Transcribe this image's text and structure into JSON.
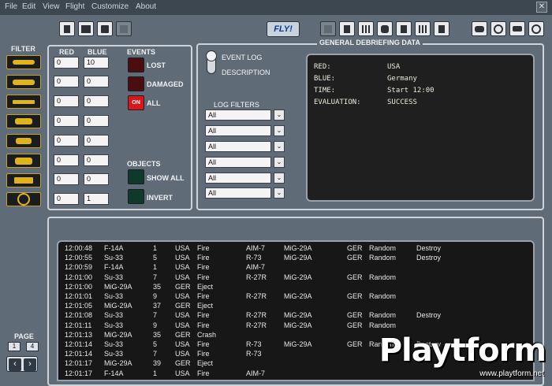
{
  "menu": [
    "File",
    "Edit",
    "View",
    "Flight",
    "Customize",
    "About"
  ],
  "close_glyph": "✕",
  "toolbar": {
    "fly_label": "FLY!"
  },
  "filter": {
    "label": "FILTER"
  },
  "counts": {
    "red_header": "RED",
    "blue_header": "BLUE",
    "red": [
      "0",
      "0",
      "0",
      "0",
      "0",
      "0",
      "0",
      "0"
    ],
    "blue": [
      "10",
      "0",
      "0",
      "0",
      "0",
      "0",
      "0",
      "1"
    ]
  },
  "events": {
    "header": "EVENTS",
    "lost": "LOST",
    "damaged": "DAMAGED",
    "all": "ALL",
    "on_indicator": "ON"
  },
  "objects": {
    "header": "OBJECTS",
    "show_all": "SHOW ALL",
    "invert": "INVERT"
  },
  "mode": {
    "event_log": "EVENT LOG",
    "description": "DESCRIPTION"
  },
  "log_filters": {
    "label": "LOG FILTERS",
    "values": [
      "All",
      "All",
      "All",
      "All",
      "All",
      "All"
    ]
  },
  "general": {
    "title": "GENERAL DEBRIEFING DATA",
    "rows": [
      {
        "k": "RED:",
        "v": "USA"
      },
      {
        "k": "BLUE:",
        "v": "Germany"
      },
      {
        "k": "TIME:",
        "v": "Start 12:00"
      },
      {
        "k": "EVALUATION:",
        "v": "SUCCESS"
      }
    ]
  },
  "log": [
    [
      "12:00:48",
      "F-14A",
      "1",
      "USA",
      "Fire",
      "AIM-7",
      "MiG-29A",
      "GER",
      "Random",
      "Destroy"
    ],
    [
      "12:00:55",
      "Su-33",
      "5",
      "USA",
      "Fire",
      "R-73",
      "MiG-29A",
      "GER",
      "Random",
      "Destroy"
    ],
    [
      "12:00:59",
      "F-14A",
      "1",
      "USA",
      "Fire",
      "AIM-7",
      "",
      "",
      "",
      ""
    ],
    [
      "12:01:00",
      "Su-33",
      "7",
      "USA",
      "Fire",
      "R-27R",
      "MiG-29A",
      "GER",
      "Random",
      ""
    ],
    [
      "12:01:00",
      "MiG-29A",
      "35",
      "GER",
      "Eject",
      "",
      "",
      "",
      "",
      ""
    ],
    [
      "12:01:01",
      "Su-33",
      "9",
      "USA",
      "Fire",
      "R-27R",
      "MiG-29A",
      "GER",
      "Random",
      ""
    ],
    [
      "12:01:05",
      "MiG-29A",
      "37",
      "GER",
      "Eject",
      "",
      "",
      "",
      "",
      ""
    ],
    [
      "12:01:08",
      "Su-33",
      "7",
      "USA",
      "Fire",
      "R-27R",
      "MiG-29A",
      "GER",
      "Random",
      "Destroy"
    ],
    [
      "12:01:11",
      "Su-33",
      "9",
      "USA",
      "Fire",
      "R-27R",
      "MiG-29A",
      "GER",
      "Random",
      ""
    ],
    [
      "12:01:13",
      "MiG-29A",
      "35",
      "GER",
      "Crash",
      "",
      "",
      "",
      "",
      ""
    ],
    [
      "12:01:14",
      "Su-33",
      "5",
      "USA",
      "Fire",
      "R-73",
      "MiG-29A",
      "GER",
      "Random",
      "Destroy"
    ],
    [
      "12:01:14",
      "Su-33",
      "7",
      "USA",
      "Fire",
      "R-73",
      "",
      "",
      "",
      ""
    ],
    [
      "12:01:17",
      "MiG-29A",
      "39",
      "GER",
      "Eject",
      "",
      "",
      "",
      "",
      ""
    ],
    [
      "12:01:17",
      "F-14A",
      "1",
      "USA",
      "Fire",
      "AIM-7",
      "",
      "",
      "",
      ""
    ]
  ],
  "page": {
    "label": "PAGE",
    "current": "1",
    "total": "4",
    "prev": "‹",
    "next": "›"
  },
  "watermark": {
    "brand": "Playtform",
    "url": "www.playtform.net"
  }
}
